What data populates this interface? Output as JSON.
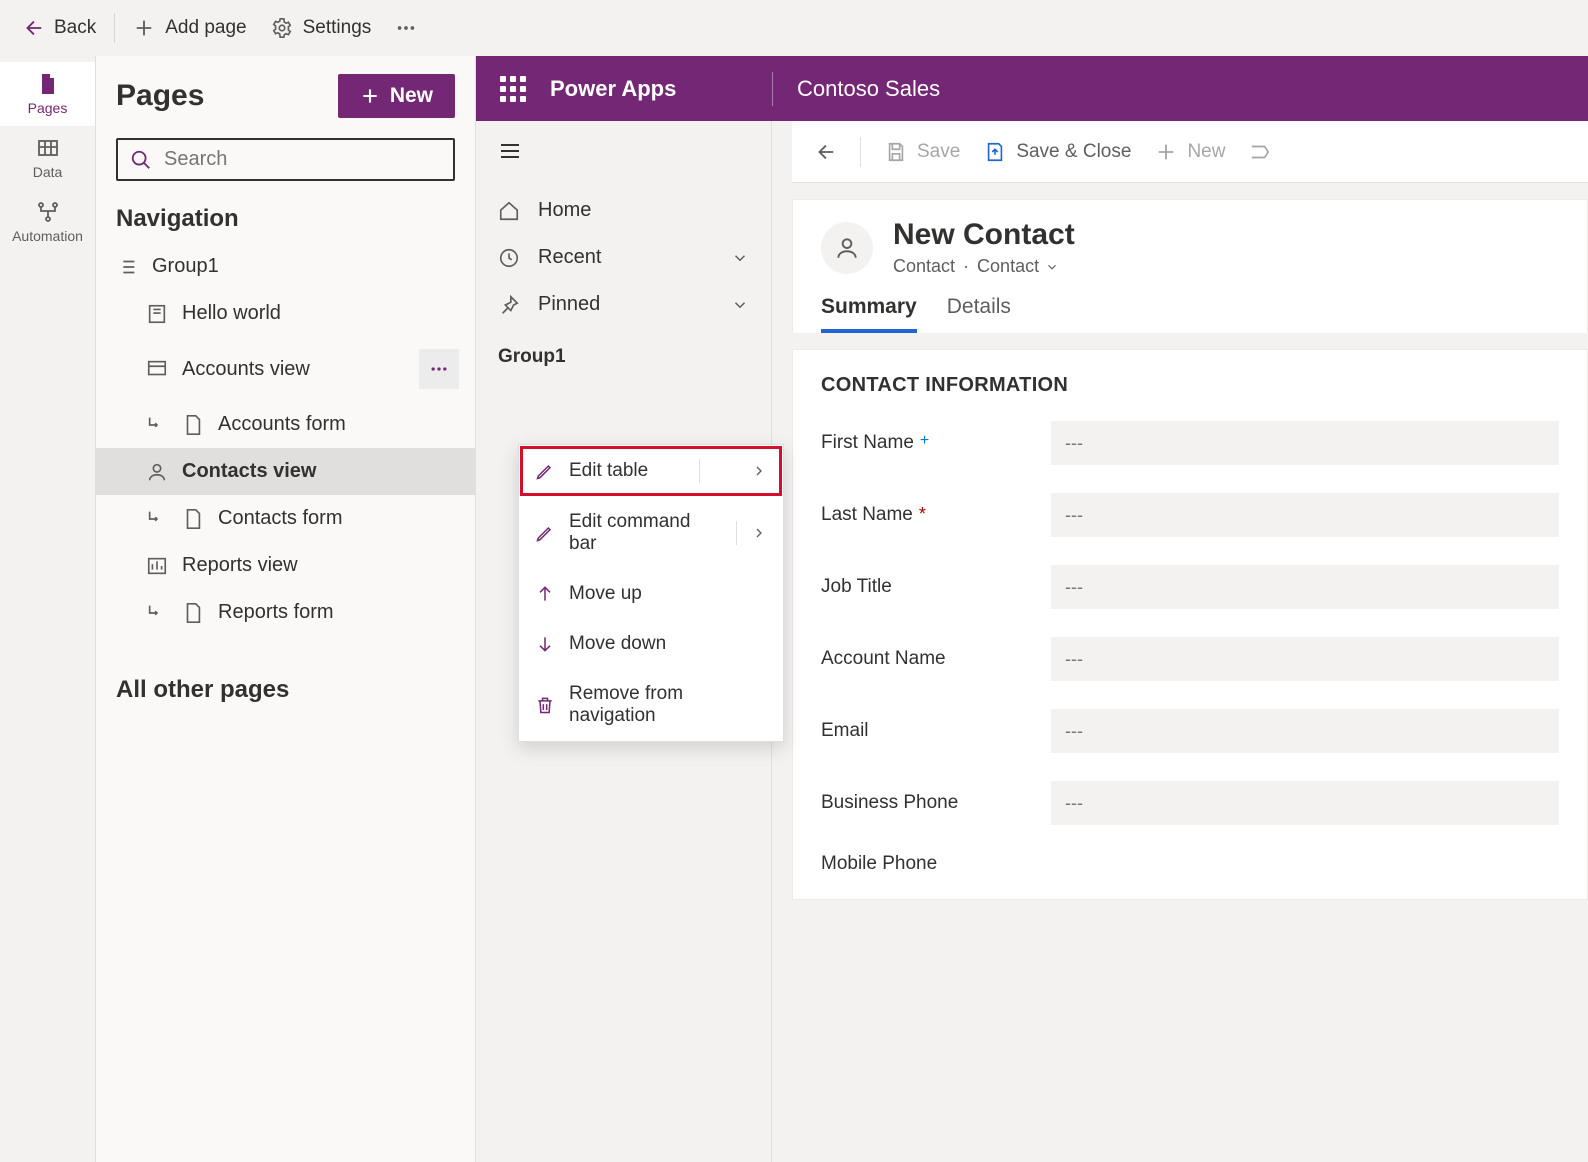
{
  "toolbar": {
    "back": "Back",
    "add_page": "Add page",
    "settings": "Settings"
  },
  "rail": {
    "pages": "Pages",
    "data": "Data",
    "automation": "Automation"
  },
  "pages_panel": {
    "title": "Pages",
    "new_btn": "New",
    "search_placeholder": "Search",
    "nav_label": "Navigation",
    "group": "Group1",
    "items": [
      {
        "label": "Hello world",
        "type": "dashboard"
      },
      {
        "label": "Accounts view",
        "type": "view"
      },
      {
        "label": "Accounts form",
        "type": "form"
      },
      {
        "label": "Contacts view",
        "type": "view",
        "selected": true
      },
      {
        "label": "Contacts form",
        "type": "form"
      },
      {
        "label": "Reports view",
        "type": "chart"
      },
      {
        "label": "Reports form",
        "type": "form"
      }
    ],
    "other_pages": "All other pages"
  },
  "context_menu": {
    "edit_table": "Edit table",
    "edit_cmd_bar": "Edit command bar",
    "move_up": "Move up",
    "move_down": "Move down",
    "remove": "Remove from navigation"
  },
  "brand": {
    "product": "Power Apps",
    "app_name": "Contoso Sales"
  },
  "app_nav": {
    "home": "Home",
    "recent": "Recent",
    "pinned": "Pinned",
    "group": "Group1"
  },
  "command_bar": {
    "save": "Save",
    "save_close": "Save & Close",
    "new": "New"
  },
  "entity": {
    "title": "New Contact",
    "type": "Contact",
    "form": "Contact",
    "tabs": {
      "summary": "Summary",
      "details": "Details"
    }
  },
  "form": {
    "section": "CONTACT INFORMATION",
    "placeholder": "---",
    "fields": {
      "first_name": "First Name",
      "last_name": "Last Name",
      "job_title": "Job Title",
      "account_name": "Account Name",
      "email": "Email",
      "business_phone": "Business Phone",
      "mobile_phone": "Mobile Phone"
    }
  }
}
